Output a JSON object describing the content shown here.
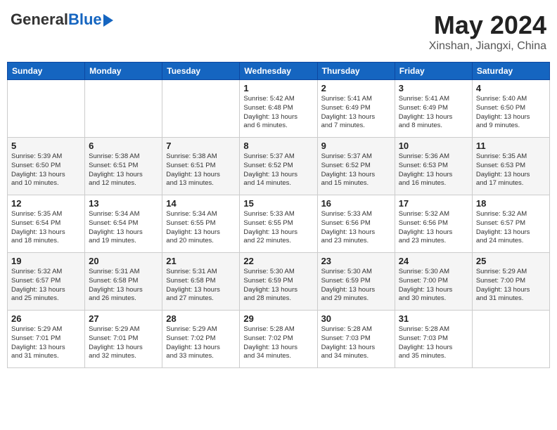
{
  "logo": {
    "general": "General",
    "blue": "Blue"
  },
  "title": {
    "month_year": "May 2024",
    "location": "Xinshan, Jiangxi, China"
  },
  "headers": [
    "Sunday",
    "Monday",
    "Tuesday",
    "Wednesday",
    "Thursday",
    "Friday",
    "Saturday"
  ],
  "weeks": [
    [
      {
        "day": "",
        "info": ""
      },
      {
        "day": "",
        "info": ""
      },
      {
        "day": "",
        "info": ""
      },
      {
        "day": "1",
        "info": "Sunrise: 5:42 AM\nSunset: 6:48 PM\nDaylight: 13 hours\nand 6 minutes."
      },
      {
        "day": "2",
        "info": "Sunrise: 5:41 AM\nSunset: 6:49 PM\nDaylight: 13 hours\nand 7 minutes."
      },
      {
        "day": "3",
        "info": "Sunrise: 5:41 AM\nSunset: 6:49 PM\nDaylight: 13 hours\nand 8 minutes."
      },
      {
        "day": "4",
        "info": "Sunrise: 5:40 AM\nSunset: 6:50 PM\nDaylight: 13 hours\nand 9 minutes."
      }
    ],
    [
      {
        "day": "5",
        "info": "Sunrise: 5:39 AM\nSunset: 6:50 PM\nDaylight: 13 hours\nand 10 minutes."
      },
      {
        "day": "6",
        "info": "Sunrise: 5:38 AM\nSunset: 6:51 PM\nDaylight: 13 hours\nand 12 minutes."
      },
      {
        "day": "7",
        "info": "Sunrise: 5:38 AM\nSunset: 6:51 PM\nDaylight: 13 hours\nand 13 minutes."
      },
      {
        "day": "8",
        "info": "Sunrise: 5:37 AM\nSunset: 6:52 PM\nDaylight: 13 hours\nand 14 minutes."
      },
      {
        "day": "9",
        "info": "Sunrise: 5:37 AM\nSunset: 6:52 PM\nDaylight: 13 hours\nand 15 minutes."
      },
      {
        "day": "10",
        "info": "Sunrise: 5:36 AM\nSunset: 6:53 PM\nDaylight: 13 hours\nand 16 minutes."
      },
      {
        "day": "11",
        "info": "Sunrise: 5:35 AM\nSunset: 6:53 PM\nDaylight: 13 hours\nand 17 minutes."
      }
    ],
    [
      {
        "day": "12",
        "info": "Sunrise: 5:35 AM\nSunset: 6:54 PM\nDaylight: 13 hours\nand 18 minutes."
      },
      {
        "day": "13",
        "info": "Sunrise: 5:34 AM\nSunset: 6:54 PM\nDaylight: 13 hours\nand 19 minutes."
      },
      {
        "day": "14",
        "info": "Sunrise: 5:34 AM\nSunset: 6:55 PM\nDaylight: 13 hours\nand 20 minutes."
      },
      {
        "day": "15",
        "info": "Sunrise: 5:33 AM\nSunset: 6:55 PM\nDaylight: 13 hours\nand 22 minutes."
      },
      {
        "day": "16",
        "info": "Sunrise: 5:33 AM\nSunset: 6:56 PM\nDaylight: 13 hours\nand 23 minutes."
      },
      {
        "day": "17",
        "info": "Sunrise: 5:32 AM\nSunset: 6:56 PM\nDaylight: 13 hours\nand 23 minutes."
      },
      {
        "day": "18",
        "info": "Sunrise: 5:32 AM\nSunset: 6:57 PM\nDaylight: 13 hours\nand 24 minutes."
      }
    ],
    [
      {
        "day": "19",
        "info": "Sunrise: 5:32 AM\nSunset: 6:57 PM\nDaylight: 13 hours\nand 25 minutes."
      },
      {
        "day": "20",
        "info": "Sunrise: 5:31 AM\nSunset: 6:58 PM\nDaylight: 13 hours\nand 26 minutes."
      },
      {
        "day": "21",
        "info": "Sunrise: 5:31 AM\nSunset: 6:58 PM\nDaylight: 13 hours\nand 27 minutes."
      },
      {
        "day": "22",
        "info": "Sunrise: 5:30 AM\nSunset: 6:59 PM\nDaylight: 13 hours\nand 28 minutes."
      },
      {
        "day": "23",
        "info": "Sunrise: 5:30 AM\nSunset: 6:59 PM\nDaylight: 13 hours\nand 29 minutes."
      },
      {
        "day": "24",
        "info": "Sunrise: 5:30 AM\nSunset: 7:00 PM\nDaylight: 13 hours\nand 30 minutes."
      },
      {
        "day": "25",
        "info": "Sunrise: 5:29 AM\nSunset: 7:00 PM\nDaylight: 13 hours\nand 31 minutes."
      }
    ],
    [
      {
        "day": "26",
        "info": "Sunrise: 5:29 AM\nSunset: 7:01 PM\nDaylight: 13 hours\nand 31 minutes."
      },
      {
        "day": "27",
        "info": "Sunrise: 5:29 AM\nSunset: 7:01 PM\nDaylight: 13 hours\nand 32 minutes."
      },
      {
        "day": "28",
        "info": "Sunrise: 5:29 AM\nSunset: 7:02 PM\nDaylight: 13 hours\nand 33 minutes."
      },
      {
        "day": "29",
        "info": "Sunrise: 5:28 AM\nSunset: 7:02 PM\nDaylight: 13 hours\nand 34 minutes."
      },
      {
        "day": "30",
        "info": "Sunrise: 5:28 AM\nSunset: 7:03 PM\nDaylight: 13 hours\nand 34 minutes."
      },
      {
        "day": "31",
        "info": "Sunrise: 5:28 AM\nSunset: 7:03 PM\nDaylight: 13 hours\nand 35 minutes."
      },
      {
        "day": "",
        "info": ""
      }
    ]
  ]
}
